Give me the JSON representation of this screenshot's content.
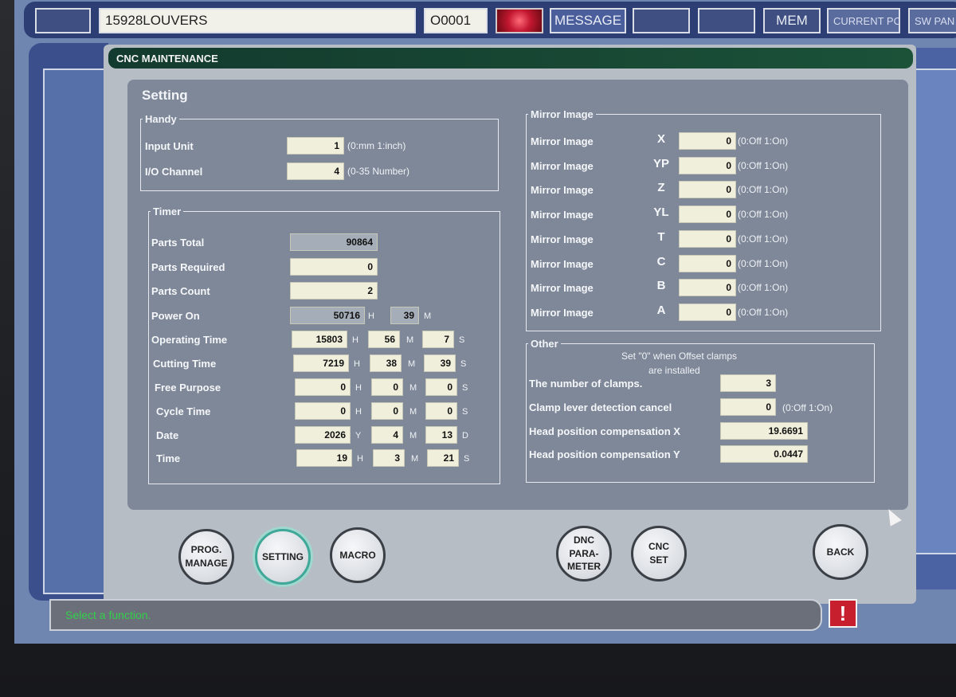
{
  "topbar": {
    "program_name": "15928LOUVERS",
    "program_number": "O0001",
    "message_label": "MESSAGE",
    "mode": "MEM",
    "current_pos": "CURRENT POS",
    "sw_panel": "SW PAN"
  },
  "panel": {
    "title": "CNC MAINTENANCE",
    "section_title": "Setting"
  },
  "handy": {
    "legend": "Handy",
    "rows": [
      {
        "label": "Input Unit",
        "value": "1",
        "hint": "(0:mm 1:inch)"
      },
      {
        "label": "I/O Channel",
        "value": "4",
        "hint": "(0-35 Number)"
      }
    ]
  },
  "timer": {
    "legend": "Timer",
    "parts_total": {
      "label": "Parts Total",
      "value": "90864"
    },
    "parts_required": {
      "label": "Parts Required",
      "value": "0"
    },
    "parts_count": {
      "label": "Parts Count",
      "value": "2"
    },
    "power_on": {
      "label": "Power On",
      "h": "50716",
      "m": "39"
    },
    "operating_time": {
      "label": "Operating Time",
      "h": "15803",
      "m": "56",
      "s": "7"
    },
    "cutting_time": {
      "label": "Cutting Time",
      "h": "7219",
      "m": "38",
      "s": "39"
    },
    "free_purpose": {
      "label": "Free Purpose",
      "h": "0",
      "m": "0",
      "s": "0"
    },
    "cycle_time": {
      "label": "Cycle Time",
      "h": "0",
      "m": "0",
      "s": "0"
    },
    "date": {
      "label": "Date",
      "y": "2026",
      "m": "4",
      "d": "13"
    },
    "time": {
      "label": "Time",
      "h": "19",
      "m": "3",
      "s": "21"
    },
    "units": {
      "h": "H",
      "m": "M",
      "s": "S",
      "y": "Y",
      "d": "D"
    }
  },
  "mirror": {
    "legend": "Mirror Image",
    "hint": "(0:Off 1:On)",
    "rows": [
      {
        "label": "Mirror Image",
        "axis": "X",
        "value": "0"
      },
      {
        "label": "Mirror Image",
        "axis": "YP",
        "value": "0"
      },
      {
        "label": "Mirror Image",
        "axis": "Z",
        "value": "0"
      },
      {
        "label": "Mirror Image",
        "axis": "YL",
        "value": "0"
      },
      {
        "label": "Mirror Image",
        "axis": "T",
        "value": "0"
      },
      {
        "label": "Mirror Image",
        "axis": "C",
        "value": "0"
      },
      {
        "label": "Mirror Image",
        "axis": "B",
        "value": "0"
      },
      {
        "label": "Mirror Image",
        "axis": "A",
        "value": "0"
      }
    ]
  },
  "other": {
    "legend": "Other",
    "note_line1": "Set \"0\" when Offset clamps",
    "note_line2": "are installed",
    "clamps": {
      "label": "The number of clamps.",
      "value": "3"
    },
    "clamp_lever": {
      "label": "Clamp lever detection cancel",
      "value": "0",
      "hint": "(0:Off 1:On)"
    },
    "head_x": {
      "label": "Head position compensation X",
      "value": "19.6691"
    },
    "head_y": {
      "label": "Head position compensation Y",
      "value": "0.0447"
    }
  },
  "buttons": {
    "prog_manage_1": "PROG.",
    "prog_manage_2": "MANAGE",
    "setting": "SETTING",
    "macro": "MACRO",
    "dnc_1": "DNC",
    "dnc_2": "PARA-",
    "dnc_3": "METER",
    "cnc_set_1": "CNC",
    "cnc_set_2": "SET",
    "back": "BACK"
  },
  "status": {
    "message": "Select a function.",
    "alert_symbol": "!"
  }
}
